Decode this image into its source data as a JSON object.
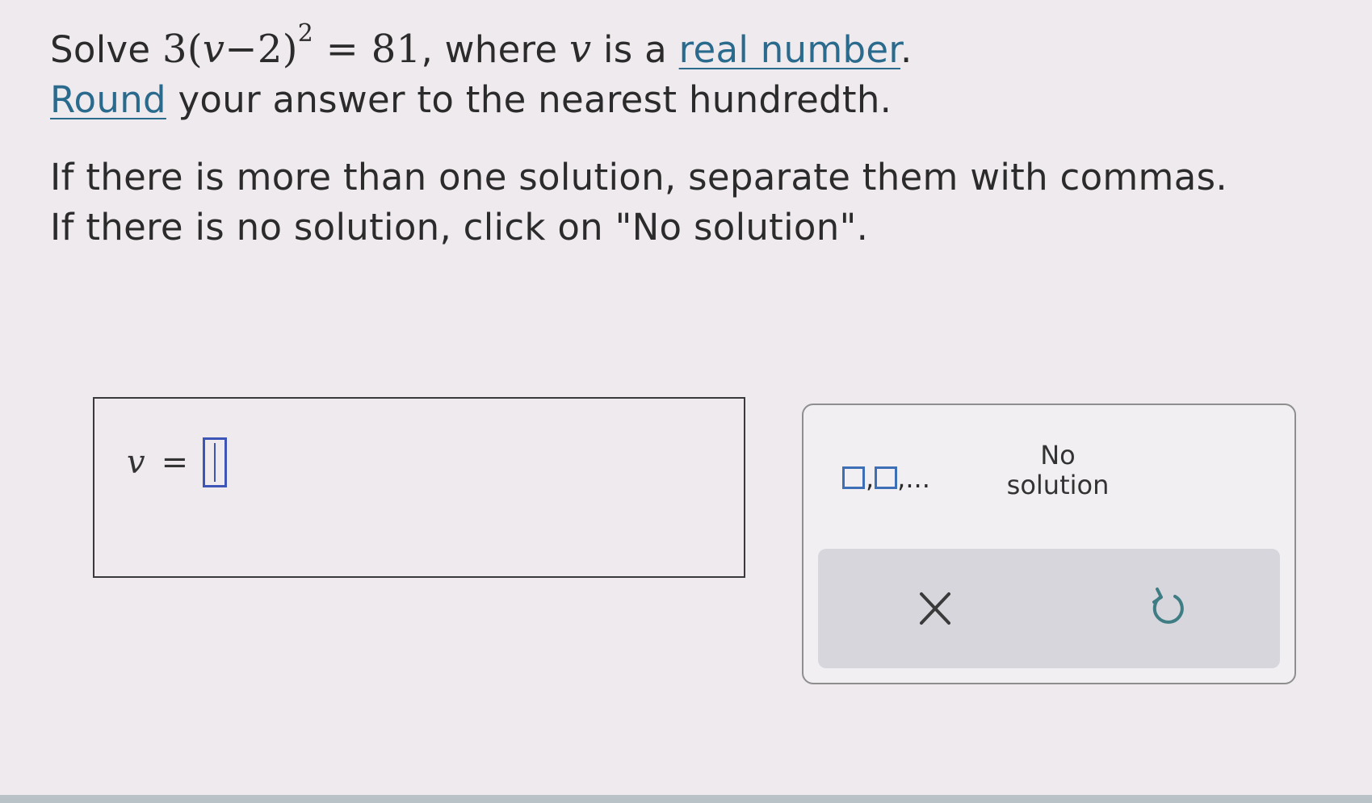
{
  "question": {
    "solve_word": "Solve",
    "equation_coef": "3",
    "equation_open": "(",
    "equation_var": "v",
    "equation_minus": "−",
    "equation_const": "2",
    "equation_close": ")",
    "equation_exp": "2",
    "equation_rhs": " = 81",
    "mid_text": ", where ",
    "var": "v",
    "is_a": " is a ",
    "real_number_link": "real number",
    "period": ".",
    "round_link": "Round",
    "round_rest": " your answer to the nearest hundredth.",
    "multi_instruction": "If there is more than one solution, separate them with commas.",
    "none_instruction": "If there is no solution, click on \"No solution\"."
  },
  "answer": {
    "variable": "v",
    "equals": "=",
    "value": ""
  },
  "keypad": {
    "multi_comma": ",",
    "multi_ellipsis": ",...",
    "no_solution_line1": "No",
    "no_solution_line2": "solution",
    "clear_icon": "close-icon",
    "undo_icon": "undo-icon"
  },
  "colors": {
    "link": "#2a6a8c",
    "input_border": "#3e55b8",
    "multi_squares": "#3c6fb6",
    "action_bar": "#d7d6dc"
  }
}
